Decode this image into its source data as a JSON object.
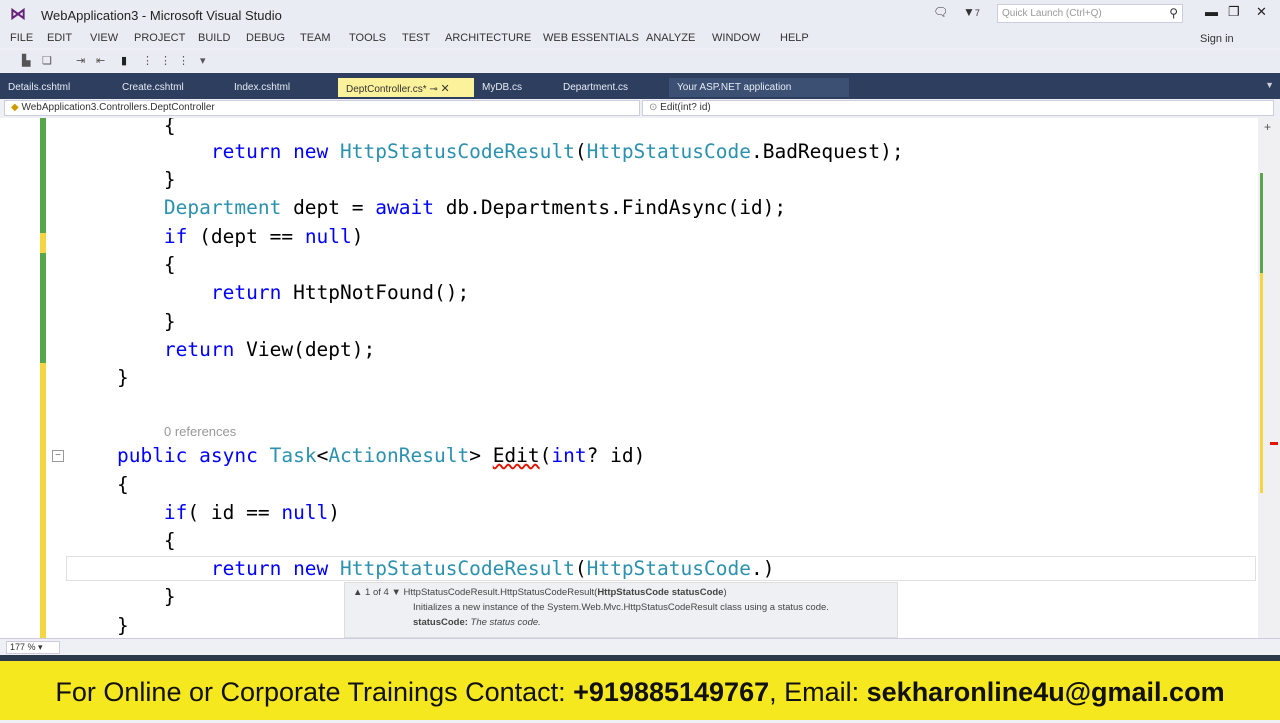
{
  "window": {
    "title": "WebApplication3 - Microsoft Visual Studio",
    "notification_count": "7",
    "quick_launch_placeholder": "Quick Launch (Ctrl+Q)"
  },
  "menu": [
    "FILE",
    "EDIT",
    "VIEW",
    "PROJECT",
    "BUILD",
    "DEBUG",
    "TEAM",
    "TOOLS",
    "TEST",
    "ARCHITECTURE",
    "WEB ESSENTIALS",
    "ANALYZE",
    "WINDOW",
    "HELP"
  ],
  "sign_in": "Sign in",
  "tabs": [
    {
      "label": "Details.cshtml"
    },
    {
      "label": "Create.cshtml"
    },
    {
      "label": "Index.cshtml"
    },
    {
      "label": "DeptController.cs*",
      "active": true
    },
    {
      "label": "MyDB.cs"
    },
    {
      "label": "Department.cs"
    },
    {
      "label": "Your ASP.NET application",
      "preview": true
    }
  ],
  "nav": {
    "class_path": "WebApplication3.Controllers.DeptController",
    "member": "Edit(int? id)"
  },
  "code": {
    "references": "0 references",
    "lines": [
      [
        [
          "        {",
          "pl"
        ]
      ],
      [
        [
          "            ",
          "pl"
        ],
        [
          "return new ",
          "kw"
        ],
        [
          "HttpStatusCodeResult",
          "ty"
        ],
        [
          "(",
          "pl"
        ],
        [
          "HttpStatusCode",
          "ty"
        ],
        [
          ".BadRequest);",
          "pl"
        ]
      ],
      [
        [
          "        }",
          "pl"
        ]
      ],
      [
        [
          "        ",
          "pl"
        ],
        [
          "Department",
          "ty"
        ],
        [
          " dept = ",
          "pl"
        ],
        [
          "await",
          "kw"
        ],
        [
          " db.Departments.FindAsync(id);",
          "pl"
        ]
      ],
      [
        [
          "        ",
          "pl"
        ],
        [
          "if",
          "kw"
        ],
        [
          " (dept == ",
          "pl"
        ],
        [
          "null",
          "kw"
        ],
        [
          ")",
          "pl"
        ]
      ],
      [
        [
          "        {",
          "pl"
        ]
      ],
      [
        [
          "            ",
          "pl"
        ],
        [
          "return",
          "kw"
        ],
        [
          " HttpNotFound();",
          "pl"
        ]
      ],
      [
        [
          "        }",
          "pl"
        ]
      ],
      [
        [
          "        ",
          "pl"
        ],
        [
          "return",
          "kw"
        ],
        [
          " View(dept);",
          "pl"
        ]
      ],
      [
        [
          "    }",
          "pl"
        ]
      ],
      [],
      [
        [
          "    ",
          "pl"
        ],
        [
          "public async ",
          "kw"
        ],
        [
          "Task",
          "ty"
        ],
        [
          "<",
          "pl"
        ],
        [
          "ActionResult",
          "ty"
        ],
        [
          "> ",
          "pl"
        ],
        [
          "Edit",
          "err"
        ],
        [
          "(",
          "pl"
        ],
        [
          "int",
          "kw"
        ],
        [
          "? id)",
          "pl"
        ]
      ],
      [
        [
          "    {",
          "pl"
        ]
      ],
      [
        [
          "        ",
          "pl"
        ],
        [
          "if",
          "kw"
        ],
        [
          "( id == ",
          "pl"
        ],
        [
          "null",
          "kw"
        ],
        [
          ")",
          "pl"
        ]
      ],
      [
        [
          "        {",
          "pl"
        ]
      ],
      [
        [
          "            ",
          "pl"
        ],
        [
          "return new ",
          "kw"
        ],
        [
          "HttpStatusCodeResult",
          "ty"
        ],
        [
          "(",
          "pl"
        ],
        [
          "HttpStatusCode",
          "ty"
        ],
        [
          ".)",
          "pl"
        ]
      ],
      [
        [
          "        }",
          "pl"
        ]
      ],
      [
        [
          "    }",
          "pl"
        ]
      ]
    ]
  },
  "tooltip": {
    "counter": "1 of 4",
    "signature": "HttpStatusCodeResult.HttpStatusCodeResult(",
    "signature_param": "HttpStatusCode statusCode",
    "signature_end": ")",
    "description": "Initializes a new instance of the System.Web.Mvc.HttpStatusCodeResult class using a status code.",
    "param_name": "statusCode:",
    "param_desc": "The status code."
  },
  "status": {
    "zoom": "177 %"
  },
  "banner": {
    "prefix": "For Online or Corporate Trainings Contact: ",
    "phone": "+919885149767",
    "mid": ", Email: ",
    "email": "sekharonline4u@gmail.com"
  },
  "colors": {
    "keyword": "#0000ff",
    "type": "#2b91af",
    "tab_bar": "#2d3e5f",
    "active_tab": "#fdf29c",
    "banner": "#f6e81e"
  }
}
